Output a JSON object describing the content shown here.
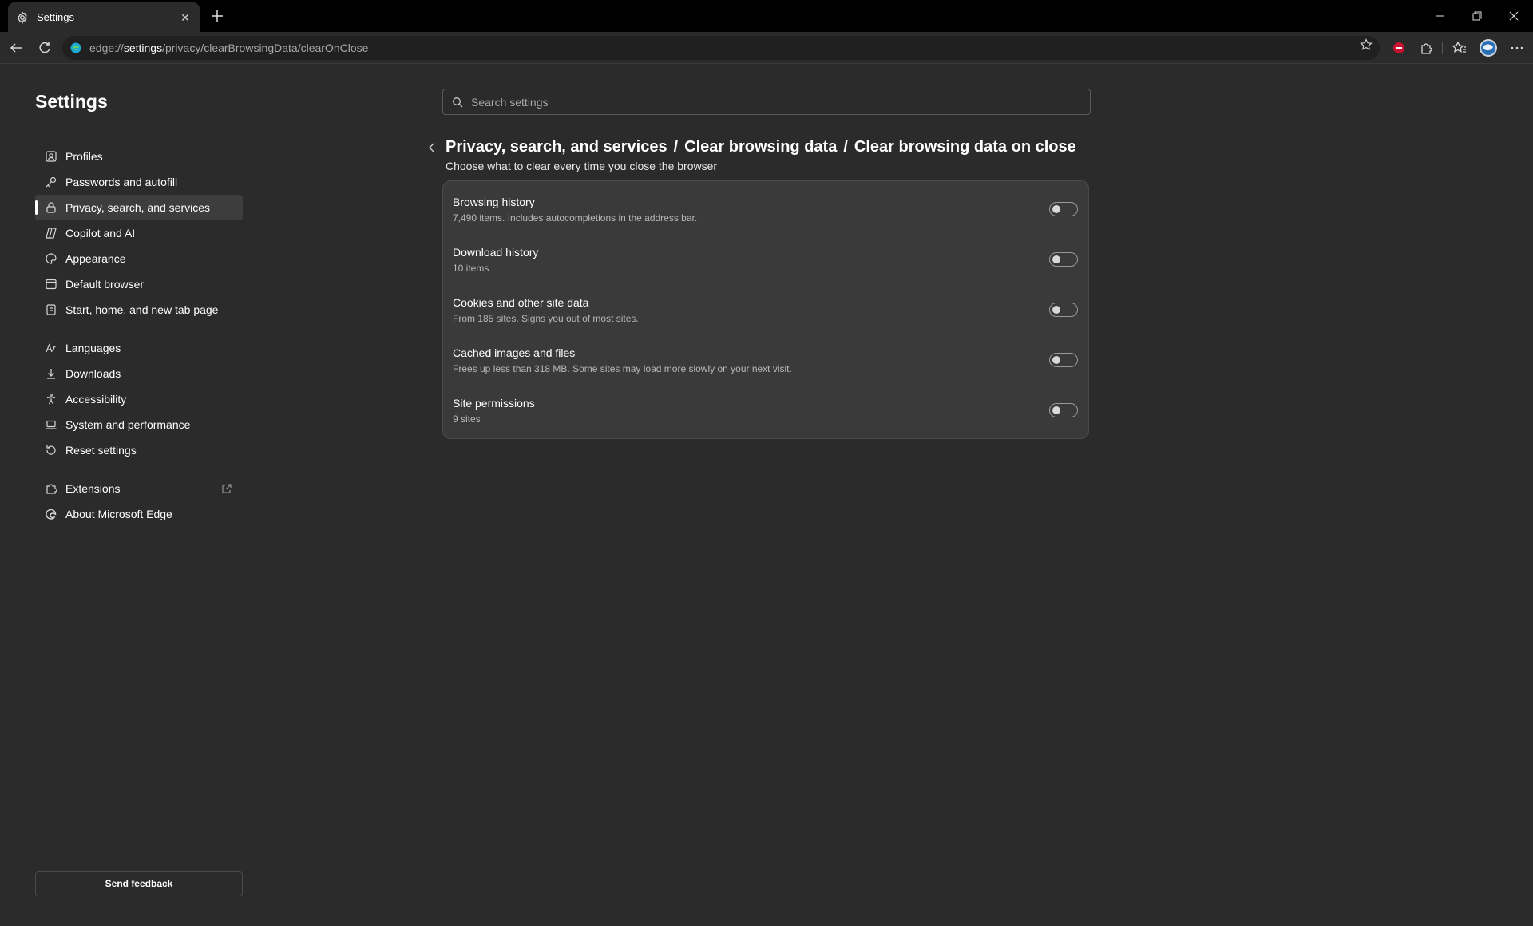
{
  "browser": {
    "tab_title": "Settings",
    "url_scheme": "edge://",
    "url_host": "settings",
    "url_path": "/privacy/clearBrowsingData/clearOnClose"
  },
  "sidebar": {
    "title": "Settings",
    "items": [
      {
        "label": "Profiles",
        "icon": "profile-icon"
      },
      {
        "label": "Passwords and autofill",
        "icon": "key-icon"
      },
      {
        "label": "Privacy, search, and services",
        "icon": "lock-icon",
        "active": true
      },
      {
        "label": "Copilot and AI",
        "icon": "copilot-icon"
      },
      {
        "label": "Appearance",
        "icon": "palette-icon"
      },
      {
        "label": "Default browser",
        "icon": "browser-icon"
      },
      {
        "label": "Start, home, and new tab page",
        "icon": "home-tabs-icon"
      },
      {
        "label": "Languages",
        "icon": "languages-icon"
      },
      {
        "label": "Downloads",
        "icon": "download-icon"
      },
      {
        "label": "Accessibility",
        "icon": "accessibility-icon"
      },
      {
        "label": "System and performance",
        "icon": "laptop-icon"
      },
      {
        "label": "Reset settings",
        "icon": "reset-icon"
      },
      {
        "label": "Extensions",
        "icon": "puzzle-icon"
      },
      {
        "label": "About Microsoft Edge",
        "icon": "edge-logo-icon"
      }
    ],
    "feedback_label": "Send feedback"
  },
  "search": {
    "placeholder": "Search settings"
  },
  "header": {
    "crumb1": "Privacy, search, and services",
    "sep1": "/",
    "crumb2": "Clear browsing data",
    "sep2": "/",
    "crumb3": "Clear browsing data on close",
    "subtitle": "Choose what to clear every time you close the browser"
  },
  "options": [
    {
      "title": "Browsing history",
      "desc": "7,490 items. Includes autocompletions in the address bar.",
      "enabled": false
    },
    {
      "title": "Download history",
      "desc": "10 items",
      "enabled": false
    },
    {
      "title": "Cookies and other site data",
      "desc": "From 185 sites. Signs you out of most sites.",
      "enabled": false
    },
    {
      "title": "Cached images and files",
      "desc": "Frees up less than 318 MB. Some sites may load more slowly on your next visit.",
      "enabled": false
    },
    {
      "title": "Site permissions",
      "desc": "9 sites",
      "enabled": false
    }
  ]
}
